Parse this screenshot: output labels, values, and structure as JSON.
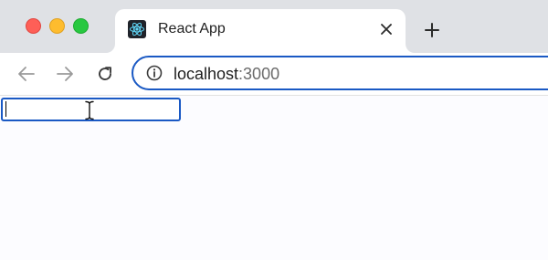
{
  "window": {
    "controls": [
      "close",
      "minimize",
      "zoom"
    ]
  },
  "tab": {
    "title": "React App",
    "favicon": "react-logo-icon",
    "close_icon": "close-icon"
  },
  "new_tab": {
    "icon": "plus-icon"
  },
  "toolbar": {
    "back_icon": "arrow-left-icon",
    "forward_icon": "arrow-right-icon",
    "reload_icon": "reload-icon",
    "site_info_icon": "info-icon"
  },
  "address_bar": {
    "host": "localhost",
    "port": ":3000"
  },
  "page": {
    "text_input": {
      "value": "",
      "placeholder": ""
    }
  },
  "colors": {
    "accent": "#1a59c4",
    "titlebar": "#dfe1e5",
    "close": "#fe5f57",
    "minimize": "#febc2e",
    "zoom": "#28c840",
    "react": "#61dafb"
  }
}
